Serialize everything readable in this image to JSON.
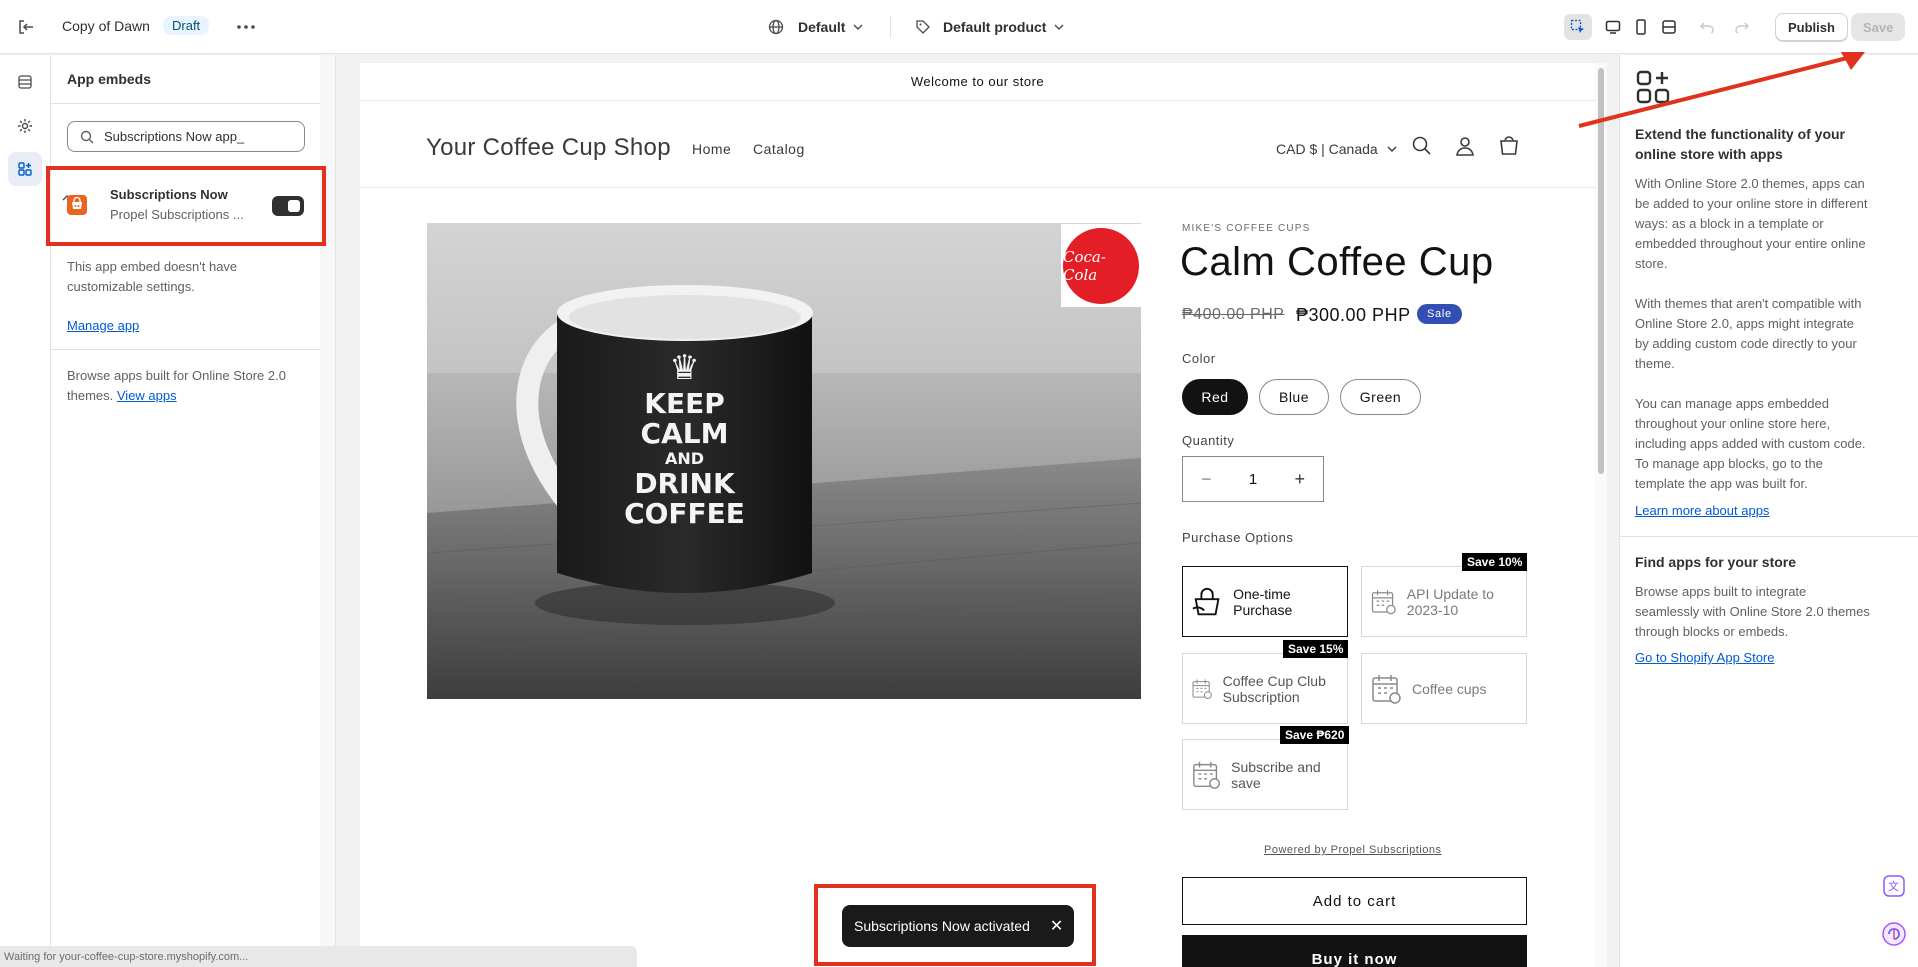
{
  "topbar": {
    "theme_name": "Copy of Dawn",
    "draft_badge": "Draft",
    "template_select": "Default",
    "product_select": "Default product",
    "publish_label": "Publish",
    "save_label": "Save"
  },
  "sidebar": {
    "title": "App embeds",
    "search_value": "Subscriptions Now app_",
    "embed": {
      "name": "Subscriptions Now",
      "subtitle": "Propel Subscriptions ...",
      "enabled": true
    },
    "no_settings_text": "This app embed doesn't have customizable settings.",
    "manage_app": "Manage app",
    "browse_text": "Browse apps built for Online Store 2.0 themes.",
    "view_apps": "View apps"
  },
  "store": {
    "announcement": "Welcome to our store",
    "logo": "Your Coffee Cup Shop",
    "nav": [
      "Home",
      "Catalog"
    ],
    "currency": "CAD $ | Canada",
    "product": {
      "vendor": "MIKE'S COFFEE CUPS",
      "title": "Calm Coffee Cup",
      "price_old": "₱400.00 PHP",
      "price_new": "₱300.00 PHP",
      "sale_badge": "Sale",
      "color_label": "Color",
      "colors": [
        "Red",
        "Blue",
        "Green"
      ],
      "selected_color": "Red",
      "quantity_label": "Quantity",
      "quantity": "1",
      "image_text": [
        "KEEP",
        "CALM",
        "AND",
        "DRINK",
        "COFFEE"
      ],
      "brand_logo_text": "Coca-Cola"
    },
    "purchase_options": {
      "label": "Purchase Options",
      "options": [
        {
          "name": "One-time Purchase",
          "tag": ""
        },
        {
          "name": "API Update to 2023-10",
          "tag": "Save 10%"
        },
        {
          "name": "Coffee Cup Club Subscription",
          "tag": "Save 15%"
        },
        {
          "name": "Coffee cups",
          "tag": ""
        },
        {
          "name": "Subscribe and save",
          "tag": "Save ₱620"
        }
      ]
    },
    "powered_by": "Powered by Propel Subscriptions",
    "add_to_cart": "Add to cart",
    "buy_now": "Buy it now"
  },
  "right_panel": {
    "heading": "Extend the functionality of your online store with apps",
    "p1": "With Online Store 2.0 themes, apps can be added to your online store in different ways: as a block in a template or embedded throughout your entire online store.",
    "p2": "With themes that aren't compatible with Online Store 2.0, apps might integrate by adding custom code directly to your theme.",
    "p3": "You can manage apps embedded throughout your online store here, including apps added with custom code. To manage app blocks, go to the template the app was built for.",
    "learn_more": "Learn more about apps",
    "find_heading": "Find apps for your store",
    "find_text": "Browse apps built to integrate seamlessly with Online Store 2.0 themes through blocks or embeds.",
    "app_store_link": "Go to Shopify App Store"
  },
  "toast": {
    "text": "Subscriptions Now activated"
  },
  "status_bar": "Waiting for your-coffee-cup-store.myshopify.com...",
  "colors": {
    "accent": "#005bd3",
    "highlight": "#e0321c",
    "sale": "#334fb4",
    "draft_bg": "#eaf4ff"
  }
}
